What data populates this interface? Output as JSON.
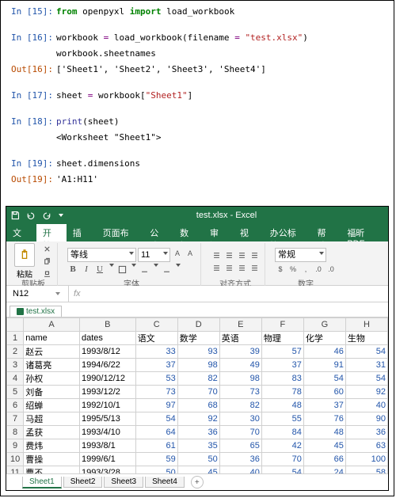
{
  "notebook": {
    "cells": [
      {
        "in_n": 15,
        "code": [
          {
            "t": "kw",
            "v": "from"
          },
          {
            "t": "sp",
            "v": " "
          },
          {
            "t": "pl",
            "v": "openpyxl "
          },
          {
            "t": "kw",
            "v": "import"
          },
          {
            "t": "sp",
            "v": " "
          },
          {
            "t": "pl",
            "v": "load_workbook"
          }
        ]
      },
      {
        "in_n": 16,
        "code": [
          {
            "t": "pl",
            "v": "workbook "
          },
          {
            "t": "op",
            "v": "="
          },
          {
            "t": "pl",
            "v": " load_workbook(filename "
          },
          {
            "t": "op",
            "v": "="
          },
          {
            "t": "pl",
            "v": " "
          },
          {
            "t": "str",
            "v": "\"test.xlsx\""
          },
          {
            "t": "pl",
            "v": ")"
          },
          {
            "t": "nl"
          },
          {
            "t": "pl",
            "v": "workbook.sheetnames"
          }
        ],
        "out": "['Sheet1', 'Sheet2', 'Sheet3', 'Sheet4']"
      },
      {
        "in_n": 17,
        "code": [
          {
            "t": "pl",
            "v": "sheet "
          },
          {
            "t": "op",
            "v": "="
          },
          {
            "t": "pl",
            "v": " workbook["
          },
          {
            "t": "str",
            "v": "\"Sheet1\""
          },
          {
            "t": "pl",
            "v": "]"
          }
        ]
      },
      {
        "in_n": 18,
        "code": [
          {
            "t": "fn",
            "v": "print"
          },
          {
            "t": "pl",
            "v": "(sheet)"
          }
        ],
        "stdout": "<Worksheet \"Sheet1\">"
      },
      {
        "in_n": 19,
        "code": [
          {
            "t": "pl",
            "v": "sheet.dimensions"
          }
        ],
        "out": "'A1:H11'"
      }
    ]
  },
  "excel": {
    "app_title": "test.xlsx  -  Excel",
    "ribbon_tabs": [
      "文件",
      "开始",
      "插入",
      "页面布局",
      "公式",
      "数据",
      "审阅",
      "视图",
      "办公标签",
      "帮助",
      "福昕PDF"
    ],
    "ribbon_active": 1,
    "group_labels": {
      "clipboard": "剪贴板",
      "paste": "粘贴",
      "font": "字体",
      "align": "对齐方式",
      "number": "数字",
      "general": "常规"
    },
    "font_name": "等线",
    "font_size": "11",
    "name_box": "N12",
    "fx_label": "fx",
    "file_tab": "test.xlsx",
    "columns": [
      "A",
      "B",
      "C",
      "D",
      "E",
      "F",
      "G",
      "H"
    ],
    "headers_row": [
      "name",
      "dates",
      "语文",
      "数学",
      "英语",
      "物理",
      "化学",
      "生物"
    ],
    "rows": [
      [
        "赵云",
        "1993/8/12",
        33,
        93,
        39,
        57,
        46,
        54
      ],
      [
        "诸葛亮",
        "1994/6/22",
        37,
        98,
        49,
        37,
        91,
        31
      ],
      [
        "孙权",
        "1990/12/12",
        53,
        82,
        98,
        83,
        54,
        54
      ],
      [
        "刘备",
        "1993/12/2",
        73,
        70,
        73,
        78,
        60,
        92
      ],
      [
        "绍蝉",
        "1992/10/1",
        97,
        68,
        82,
        48,
        37,
        40
      ],
      [
        "马超",
        "1995/5/13",
        54,
        92,
        30,
        55,
        76,
        90
      ],
      [
        "孟获",
        "1993/4/10",
        64,
        36,
        70,
        84,
        48,
        36
      ],
      [
        "费炜",
        "1993/8/1",
        61,
        35,
        65,
        42,
        45,
        63
      ],
      [
        "曹操",
        "1999/6/1",
        59,
        50,
        36,
        70,
        66,
        100
      ],
      [
        "曹丕",
        "1993/3/28",
        50,
        45,
        40,
        54,
        24,
        58
      ]
    ],
    "sheet_tabs": [
      "Sheet1",
      "Sheet2",
      "Sheet3",
      "Sheet4"
    ],
    "sheet_active": 0
  }
}
